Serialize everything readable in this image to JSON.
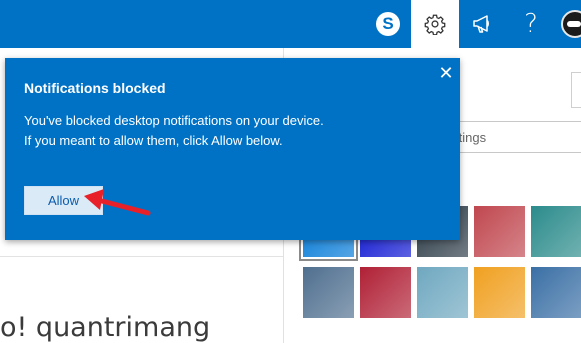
{
  "topbar": {
    "skype_icon": "skype-icon",
    "skype_glyph": "S",
    "settings_icon": "gear-icon",
    "announce_icon": "megaphone-icon",
    "help_glyph": "?",
    "colors": {
      "bar": "#0072c6",
      "active": "#ffffff"
    }
  },
  "background": {
    "greeting": "o! quantrimang"
  },
  "settings_pane": {
    "search_value": "ttings",
    "theme_swatches": [
      {
        "name": "blue",
        "color": "#0078d7",
        "selected": true
      },
      {
        "name": "navy",
        "color": "#0a12d1",
        "selected": false
      },
      {
        "name": "circuit-dark",
        "color": "#2b3a46",
        "selected": false
      },
      {
        "name": "palm-sunset",
        "color": "#c0474f",
        "selected": false
      },
      {
        "name": "circuit-teal",
        "color": "#2b8b8b",
        "selected": false
      },
      {
        "name": "blueprint",
        "color": "#4f6f8f",
        "selected": false
      },
      {
        "name": "bokeh-red",
        "color": "#b02035",
        "selected": false
      },
      {
        "name": "mountains",
        "color": "#6fa8c0",
        "selected": false
      },
      {
        "name": "starfish",
        "color": "#f0a020",
        "selected": false
      },
      {
        "name": "water-blue",
        "color": "#3a6fa5",
        "selected": false
      }
    ]
  },
  "callout": {
    "title": "Notifications blocked",
    "body": "You've blocked desktop notifications on your device. If you meant to allow them, click Allow below.",
    "allow_label": "Allow",
    "close_glyph": "✕",
    "colors": {
      "bg": "#0072c6",
      "button": "#dbeaf7",
      "arrow": "#e8202a"
    }
  }
}
